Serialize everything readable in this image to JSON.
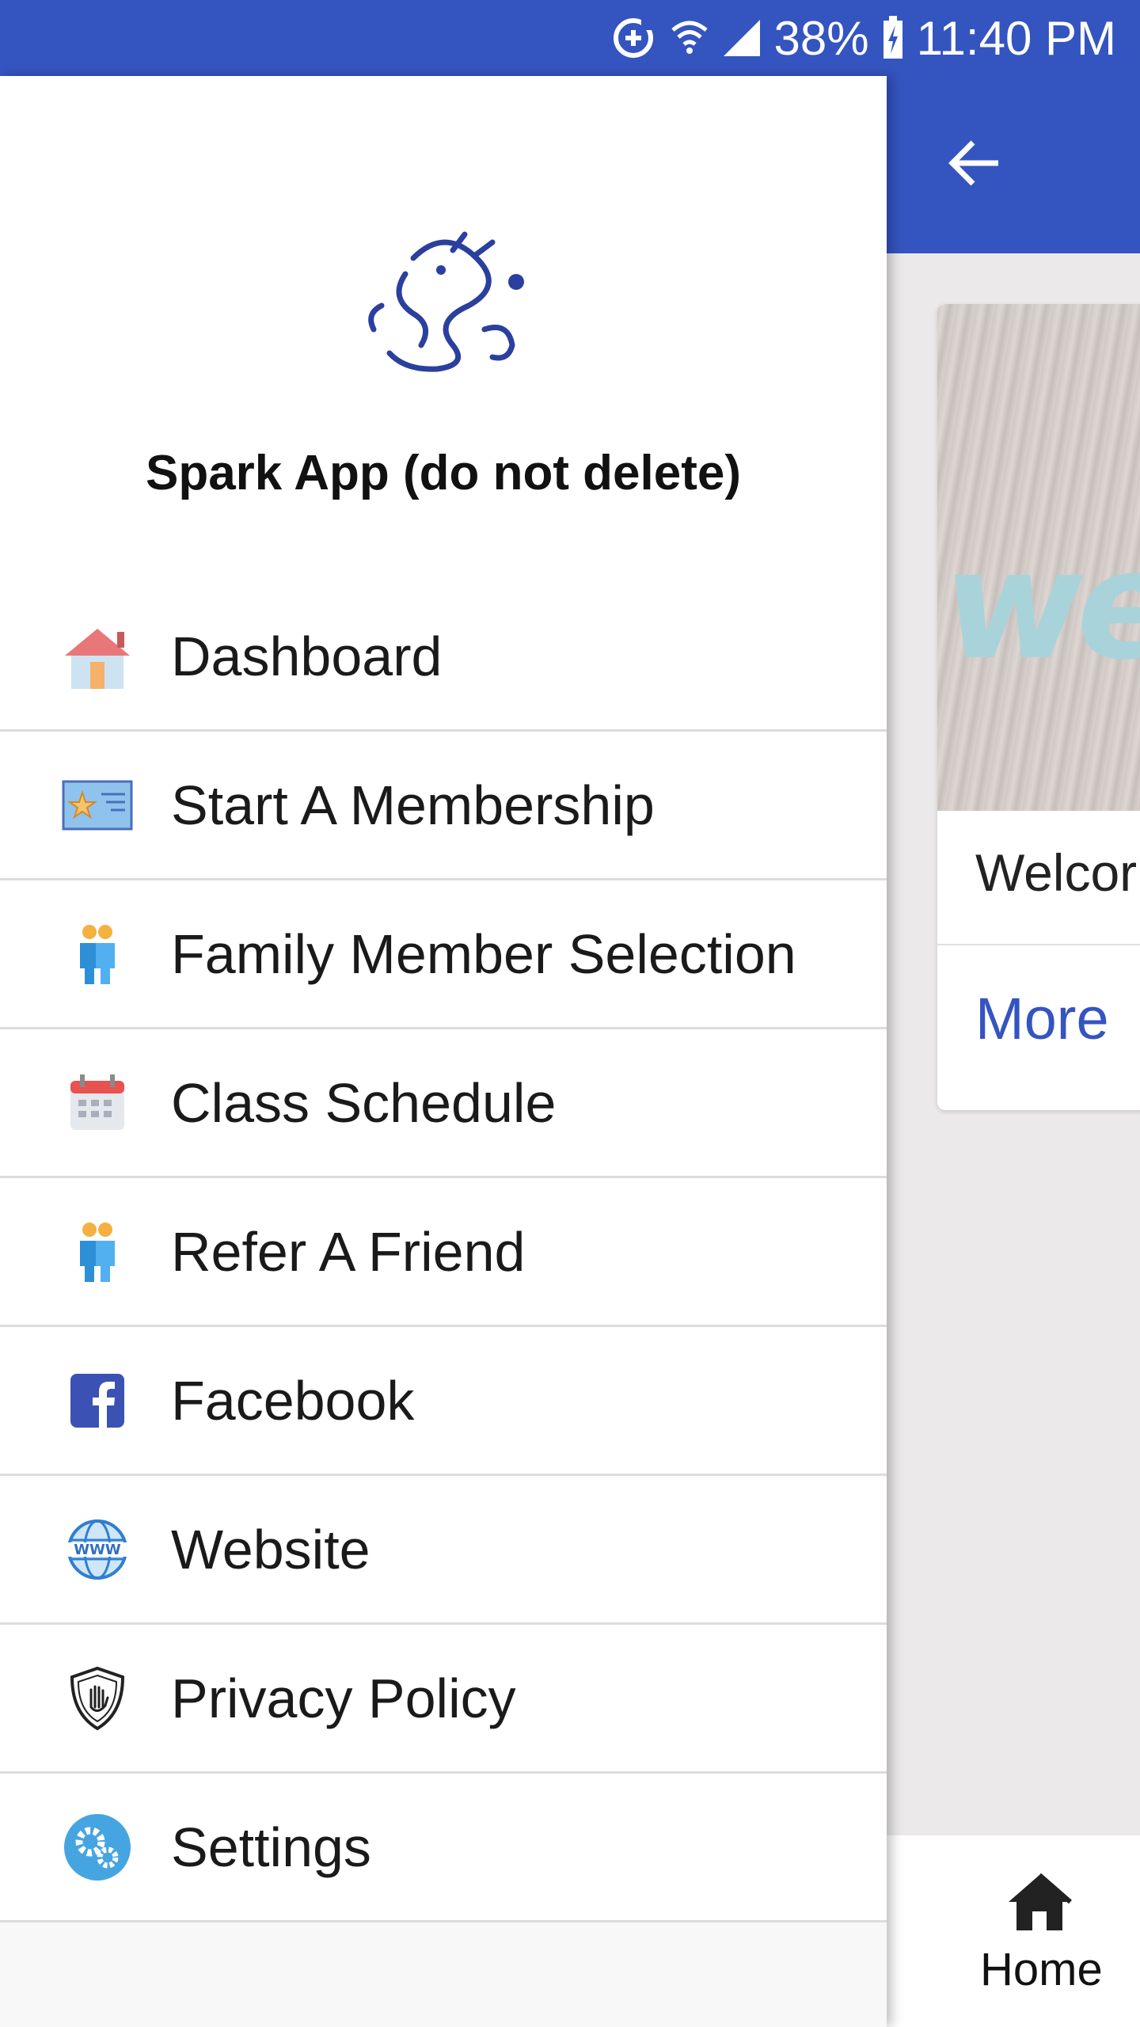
{
  "status_bar": {
    "battery": "38%",
    "time": "11:40 PM",
    "icons": [
      "sync-plus-icon",
      "wifi-icon",
      "signal-icon",
      "battery-charging-icon"
    ],
    "background_color": "#3454c0"
  },
  "background_screen": {
    "toolbar_color": "#3454c0",
    "back_icon": "arrow-left-icon",
    "card": {
      "image_word": "we",
      "title": "Welcor",
      "more_label": "More"
    },
    "bottom_nav": {
      "home_icon": "home-icon",
      "home_label": "Home"
    }
  },
  "drawer": {
    "logo": "dragon-logo",
    "app_title": "Spark App (do not delete)",
    "items": [
      {
        "label": "Dashboard",
        "icon": "house-icon"
      },
      {
        "label": "Start A Membership",
        "icon": "membership-card-icon"
      },
      {
        "label": "Family Member Selection",
        "icon": "family-icon"
      },
      {
        "label": "Class Schedule",
        "icon": "calendar-icon"
      },
      {
        "label": "Refer A Friend",
        "icon": "friends-icon"
      },
      {
        "label": "Facebook",
        "icon": "facebook-icon"
      },
      {
        "label": "Website",
        "icon": "globe-www-icon"
      },
      {
        "label": "Privacy Policy",
        "icon": "shield-hand-icon"
      },
      {
        "label": "Settings",
        "icon": "gears-icon"
      }
    ]
  },
  "colors": {
    "accent": "#3454c0",
    "divider": "#dcdcdc"
  }
}
